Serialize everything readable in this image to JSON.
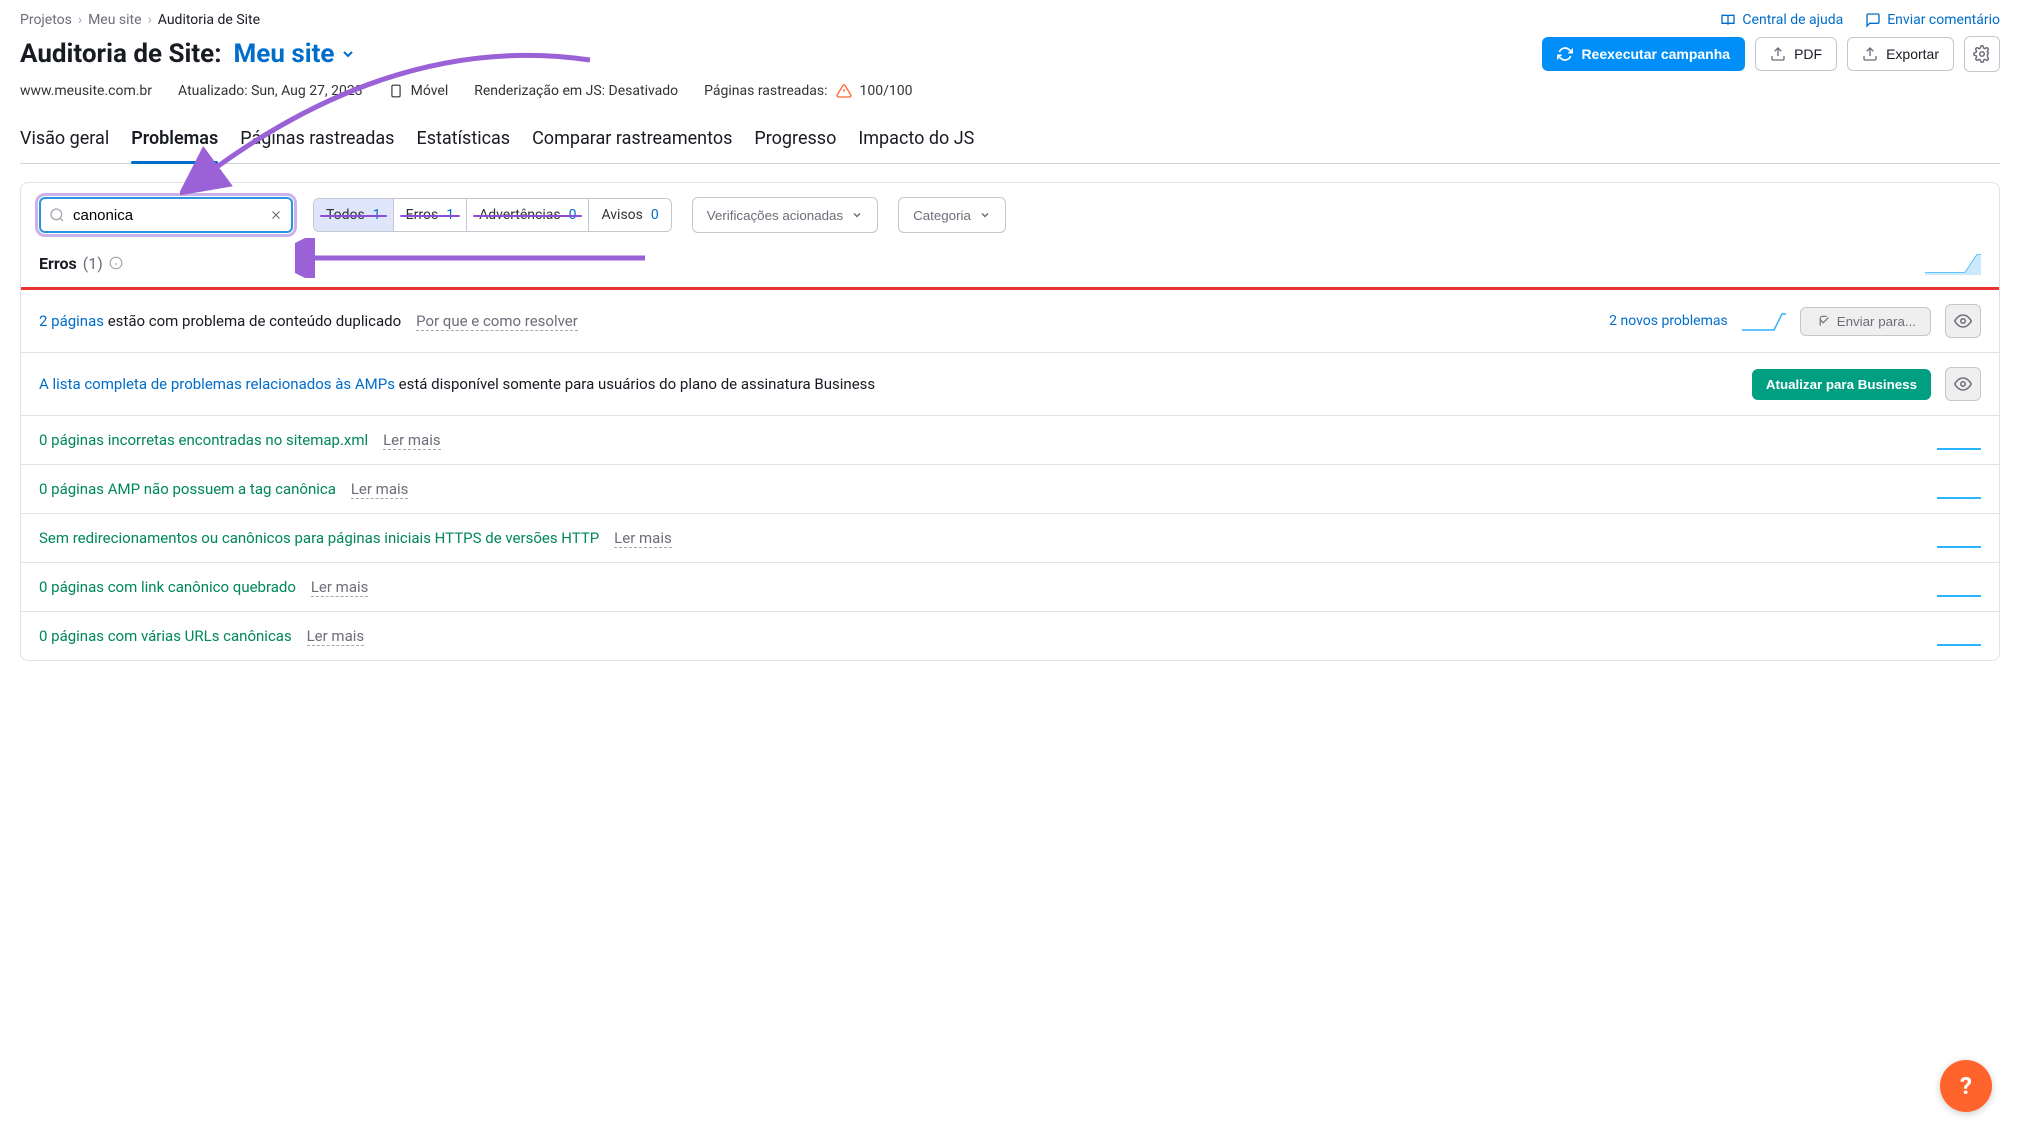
{
  "breadcrumb": {
    "root": "Projetos",
    "site": "Meu site",
    "current": "Auditoria de Site"
  },
  "toplinks": {
    "help": "Central de ajuda",
    "feedback": "Enviar comentário"
  },
  "title": {
    "label": "Auditoria de Site:",
    "project": "Meu site"
  },
  "actions": {
    "rerun": "Reexecutar campanha",
    "pdf": "PDF",
    "export": "Exportar"
  },
  "info": {
    "domain": "www.meusite.com.br",
    "updated": "Atualizado: Sun, Aug 27, 2023",
    "device": "Móvel",
    "js": "Renderização em JS: Desativado",
    "crawled_label": "Páginas rastreadas:",
    "crawled_value": "100/100"
  },
  "tabs": [
    "Visão geral",
    "Problemas",
    "Páginas rastreadas",
    "Estatísticas",
    "Comparar rastreamentos",
    "Progresso",
    "Impacto do JS"
  ],
  "activeTab": 1,
  "search_value": "canonica",
  "filter_pills": [
    {
      "label": "Todos",
      "count": "1"
    },
    {
      "label": "Erros",
      "count": "1"
    },
    {
      "label": "Advertências",
      "count": "0"
    },
    {
      "label": "Avisos",
      "count": "0"
    }
  ],
  "dropdowns": {
    "checks": "Verificações acionadas",
    "category": "Categoria"
  },
  "section": {
    "label": "Erros",
    "count": "(1)"
  },
  "rows": [
    {
      "type": "blue",
      "prefix": "2 páginas",
      "text": " estão com problema de conteúdo duplicado",
      "more": "Por que e como resolver",
      "extra": "2 novos problemas",
      "send": "Enviar para..."
    },
    {
      "type": "blue",
      "prefix": "A lista completa de problemas relacionados às AMPs",
      "text": " está disponível somente para usuários do plano de assinatura Business",
      "upgrade": "Atualizar para Business"
    },
    {
      "type": "green",
      "prefix": "0 páginas incorretas encontradas no sitemap.xml",
      "more": "Ler mais"
    },
    {
      "type": "green",
      "prefix": "0 páginas AMP não possuem a tag canônica",
      "more": "Ler mais"
    },
    {
      "type": "green",
      "prefix": "Sem redirecionamentos ou canônicos para páginas iniciais HTTPS de versões HTTP",
      "more": "Ler mais"
    },
    {
      "type": "green",
      "prefix": "0 páginas com link canônico quebrado",
      "more": "Ler mais"
    },
    {
      "type": "green",
      "prefix": "0 páginas com várias URLs canônicas",
      "more": "Ler mais"
    }
  ]
}
